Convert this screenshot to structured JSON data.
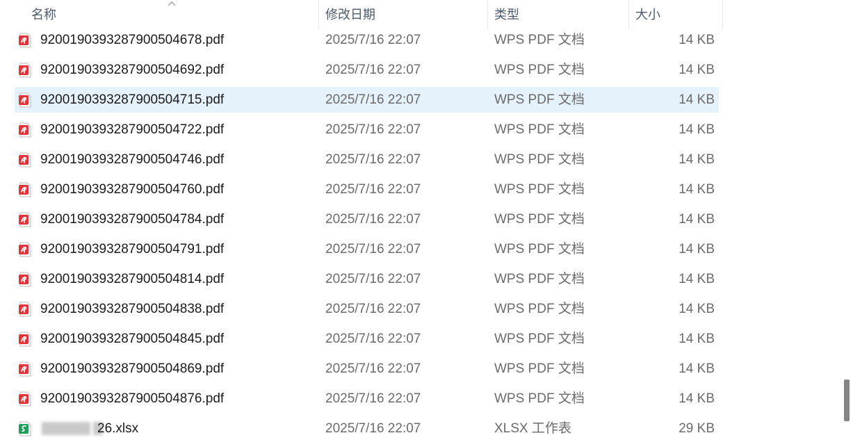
{
  "header": {
    "columns": {
      "name": "名称",
      "date": "修改日期",
      "type": "类型",
      "size": "大小"
    }
  },
  "files": [
    {
      "name": "92001903932879005046 78.pdf",
      "date": "2025/7/16 22:07",
      "type": "WPS PDF 文档",
      "size": "14 KB",
      "icon": "pdf-icon",
      "selected": false
    },
    {
      "name": "920019039328790050469 2.pdf",
      "date": "2025/7/16 22:07",
      "type": "WPS PDF 文档",
      "size": "14 KB",
      "icon": "pdf-icon",
      "selected": false
    },
    {
      "name": "92001903932879005047 15.pdf",
      "date": "2025/7/16 22:07",
      "type": "WPS PDF 文档",
      "size": "14 KB",
      "icon": "pdf-icon",
      "selected": true
    },
    {
      "name": "92001903932879005047 22.pdf",
      "date": "2025/7/16 22:07",
      "type": "WPS PDF 文档",
      "size": "14 KB",
      "icon": "pdf-icon",
      "selected": false
    },
    {
      "name": "92001903932879005047 46.pdf",
      "date": "2025/7/16 22:07",
      "type": "WPS PDF 文档",
      "size": "14 KB",
      "icon": "pdf-icon",
      "selected": false
    },
    {
      "name": "92001903932879005047 60.pdf",
      "date": "2025/7/16 22:07",
      "type": "WPS PDF 文档",
      "size": "14 KB",
      "icon": "pdf-icon",
      "selected": false
    },
    {
      "name": "92001903932879005047 84.pdf",
      "date": "2025/7/16 22:07",
      "type": "WPS PDF 文档",
      "size": "14 KB",
      "icon": "pdf-icon",
      "selected": false
    },
    {
      "name": "92001903932879005047 91.pdf",
      "date": "2025/7/16 22:07",
      "type": "WPS PDF 文档",
      "size": "14 KB",
      "icon": "pdf-icon",
      "selected": false
    },
    {
      "name": "92001903932879005048 14.pdf",
      "date": "2025/7/16 22:07",
      "type": "WPS PDF 文档",
      "size": "14 KB",
      "icon": "pdf-icon",
      "selected": false
    },
    {
      "name": "92001903932879005048 38.pdf",
      "date": "2025/7/16 22:07",
      "type": "WPS PDF 文档",
      "size": "14 KB",
      "icon": "pdf-icon",
      "selected": false
    },
    {
      "name": "92001903932879005048 45.pdf",
      "date": "2025/7/16 22:07",
      "type": "WPS PDF 文档",
      "size": "14 KB",
      "icon": "pdf-icon",
      "selected": false
    },
    {
      "name": "92001903932879005048 69.pdf",
      "date": "2025/7/16 22:07",
      "type": "WPS PDF 文档",
      "size": "14 KB",
      "icon": "pdf-icon",
      "selected": false
    },
    {
      "name": "92001903932879005048 76.pdf",
      "date": "2025/7/16 22:07",
      "type": "WPS PDF 文档",
      "size": "14 KB",
      "icon": "pdf-icon",
      "selected": false
    },
    {
      "name": "26.xlsx",
      "date": "2025/7/16 22:07",
      "type": "XLSX 工作表",
      "size": "29 KB",
      "icon": "xlsx-icon",
      "selected": false,
      "blurred_prefix": true
    }
  ],
  "colors": {
    "selection": "#e5f1fb",
    "pdf_red": "#e2323a",
    "xlsx_green": "#1e9e5a"
  }
}
